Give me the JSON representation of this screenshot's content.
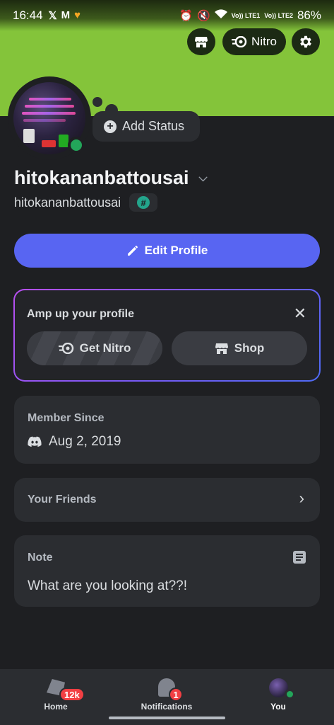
{
  "status_bar": {
    "time": "16:44",
    "left_icons": [
      "x-icon",
      "gmail-icon",
      "heart-icon"
    ],
    "right_icons": [
      "alarm-icon",
      "mute-icon",
      "wifi-icon",
      "signal-lte1-icon",
      "signal-lte2-icon"
    ],
    "volte1": "Vo)) LTE1",
    "volte2": "Vo)) LTE2",
    "battery": "86%"
  },
  "header": {
    "shop_icon": "shop-icon",
    "nitro_label": "Nitro",
    "settings_icon": "gear-icon",
    "banner_color": "#84c43a"
  },
  "profile": {
    "add_status_label": "Add Status",
    "display_name": "hitokananbattousai",
    "username": "hitokananbattousai",
    "badge_glyph": "#",
    "online_color": "#23a55a"
  },
  "edit_profile_label": "Edit Profile",
  "amp_card": {
    "title": "Amp up your profile",
    "close_glyph": "✕",
    "get_nitro_label": "Get Nitro",
    "shop_label": "Shop"
  },
  "member_since": {
    "label": "Member Since",
    "date": "Aug 2, 2019"
  },
  "friends": {
    "label": "Your Friends",
    "arrow": "›"
  },
  "note": {
    "label": "Note",
    "text": "What are you looking at??!"
  },
  "bottom_nav": {
    "home_label": "Home",
    "home_badge": "12k",
    "notifications_label": "Notifications",
    "notifications_badge": "1",
    "you_label": "You"
  },
  "colors": {
    "accent": "#5865f2",
    "background": "#1e1f22",
    "card": "#2b2d31",
    "badge_red": "#f23f43"
  }
}
